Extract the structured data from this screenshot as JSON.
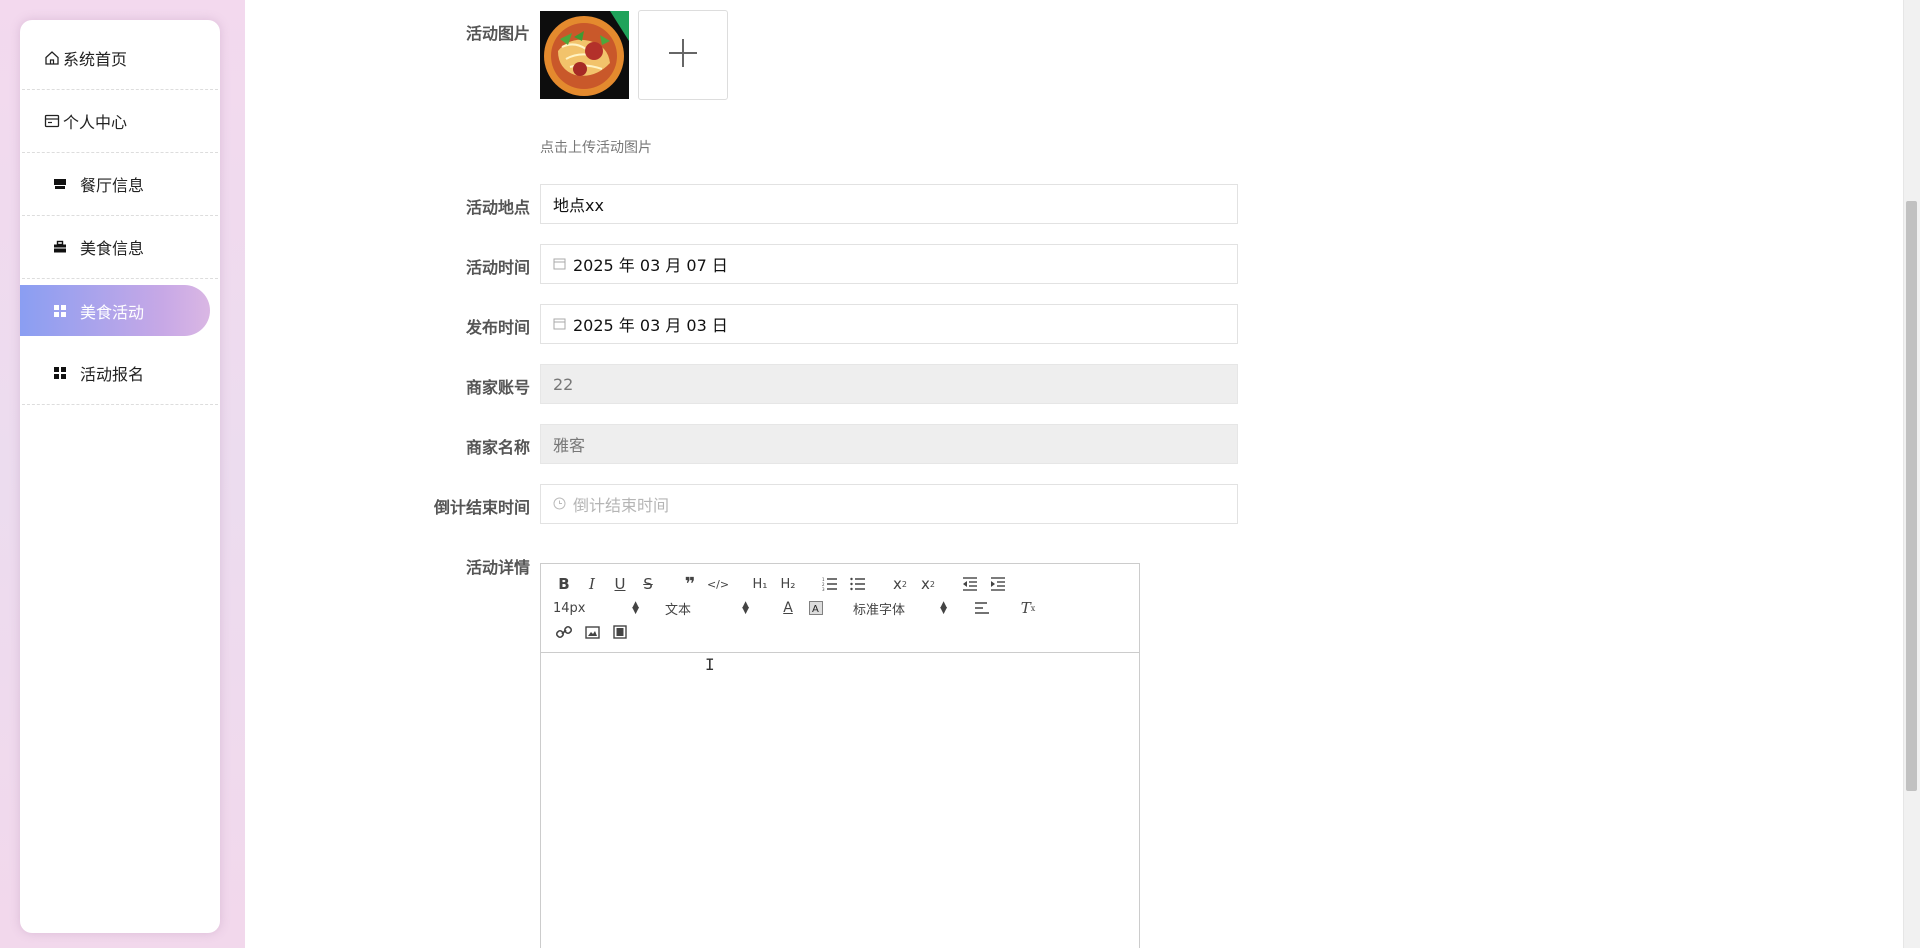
{
  "sidebar": {
    "items": [
      {
        "label": "系统首页",
        "icon": "home-icon"
      },
      {
        "label": "个人中心",
        "icon": "id-card-icon"
      },
      {
        "label": "餐厅信息",
        "icon": "store-icon"
      },
      {
        "label": "美食信息",
        "icon": "briefcase-icon"
      },
      {
        "label": "美食活动",
        "icon": "grid-icon",
        "active": true
      },
      {
        "label": "活动报名",
        "icon": "grid-icon"
      }
    ]
  },
  "form": {
    "image_label": "活动图片",
    "upload_hint": "点击上传活动图片",
    "location_label": "活动地点",
    "location_value": "地点xx",
    "activity_time_label": "活动时间",
    "activity_time_value": "2025 年 03 月 07 日",
    "publish_time_label": "发布时间",
    "publish_time_value": "2025 年 03 月 03 日",
    "merchant_account_label": "商家账号",
    "merchant_account_value": "22",
    "merchant_name_label": "商家名称",
    "merchant_name_value": "雅客",
    "countdown_label": "倒计结束时间",
    "countdown_placeholder": "倒计结束时间",
    "details_label": "活动详情"
  },
  "editor": {
    "font_size": "14px",
    "text_style": "文本",
    "font_family": "标准字体"
  },
  "colors": {
    "active_start": "#8a9ef2",
    "active_end": "#dab7e4",
    "sidebar_bg": "#f3d9ee"
  }
}
